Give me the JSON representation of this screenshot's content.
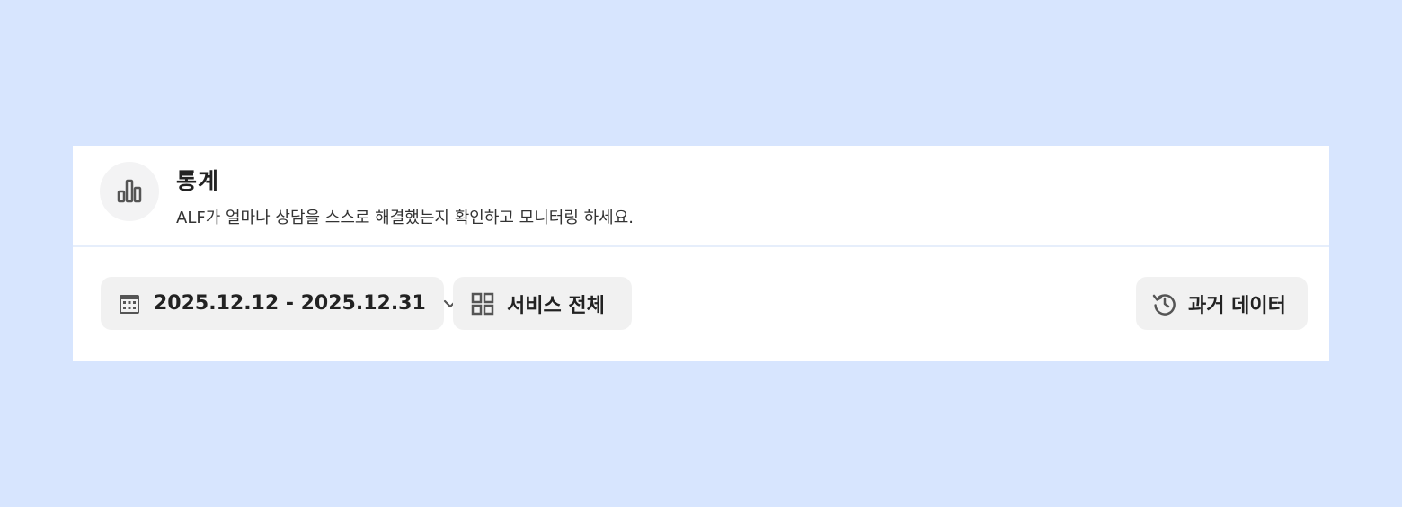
{
  "header": {
    "icon": "bar-chart-icon",
    "title": "통계",
    "subtitle": "ALF가 얼마나 상담을 스스로 해결했는지 확인하고 모니터링 하세요."
  },
  "toolbar": {
    "date_range": {
      "icon": "calendar-icon",
      "label": "2025.12.12 - 2025.12.31",
      "dropdown_icon": "chevron-down-icon"
    },
    "service_filter": {
      "icon": "grid-icon",
      "label": "서비스 전체"
    },
    "history": {
      "icon": "history-icon",
      "label": "과거 데이터"
    }
  },
  "colors": {
    "page_background": "#d7e5fe",
    "panel_background": "#ffffff",
    "button_background": "#f1f1f1",
    "text_primary": "#222222"
  }
}
